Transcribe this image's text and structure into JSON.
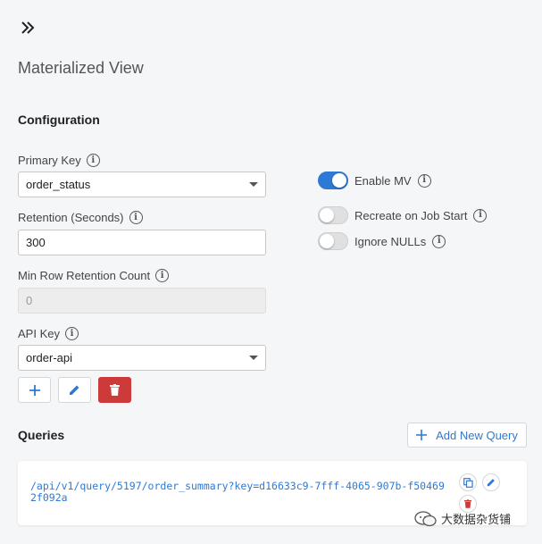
{
  "page": {
    "title": "Materialized View"
  },
  "configuration": {
    "section_title": "Configuration",
    "primary_key": {
      "label": "Primary Key",
      "value": "order_status"
    },
    "retention": {
      "label": "Retention (Seconds)",
      "value": "300"
    },
    "min_row_retention": {
      "label": "Min Row Retention Count",
      "value": "0"
    },
    "api_key": {
      "label": "API Key",
      "value": "order-api"
    },
    "toggles": {
      "enable_mv": {
        "label": "Enable MV",
        "on": true
      },
      "recreate_on_job_start": {
        "label": "Recreate on Job Start",
        "on": false
      },
      "ignore_nulls": {
        "label": "Ignore NULLs",
        "on": false
      }
    }
  },
  "queries": {
    "section_title": "Queries",
    "add_button_label": "Add New Query",
    "items": [
      {
        "url": "/api/v1/query/5197/order_summary?key=d16633c9-7fff-4065-907b-f504692f092a"
      }
    ]
  },
  "watermark": {
    "text": "大数据杂货铺"
  },
  "colors": {
    "accent": "#2e79d6",
    "danger": "#cc3a3a",
    "background": "#f5f6f8"
  }
}
